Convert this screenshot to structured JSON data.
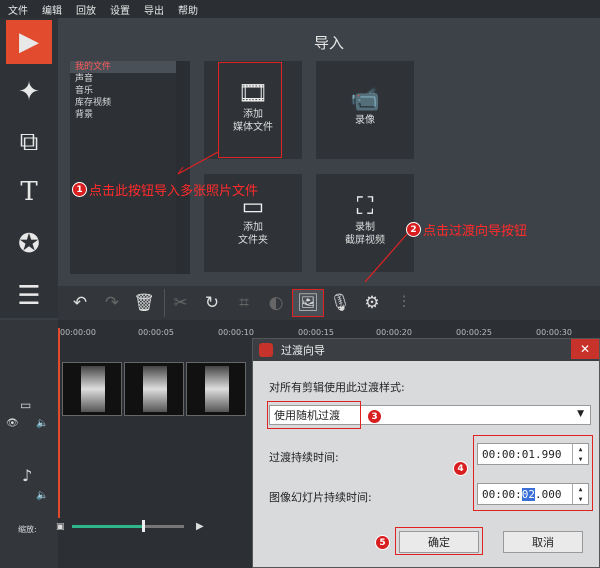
{
  "menu": [
    "文件",
    "编辑",
    "回放",
    "设置",
    "导出",
    "帮助"
  ],
  "panel_title": "导入",
  "file_tree": [
    "我的文件",
    "声音",
    "音乐",
    "库存视频",
    "背景"
  ],
  "tiles": {
    "add_media": "添加\n媒体文件",
    "record": "录像",
    "add_folder": "添加\n文件夹",
    "record_screen": "录制\n截屏视频"
  },
  "annotations": {
    "a1": "点击此按钮导入多张照片文件",
    "a2": "点击过渡向导按钮",
    "n1": "1",
    "n2": "2",
    "n3": "3",
    "n4": "4",
    "n5": "5"
  },
  "ruler": [
    "00:00:00",
    "00:00:05",
    "00:00:10",
    "00:00:15",
    "00:00:20",
    "00:00:25",
    "00:00:30"
  ],
  "zoom_label": "缩放:",
  "dialog": {
    "title": "过渡向导",
    "prompt": "对所有剪辑使用此过渡样式:",
    "style_value": "使用随机过渡",
    "duration_label": "过渡持续时间:",
    "duration_value": "00:00:01.990",
    "slide_label": "图像幻灯片持续时间:",
    "slide_pre": "00:00:",
    "slide_sel": "02",
    "slide_post": ".000",
    "ok": "确定",
    "cancel": "取消"
  },
  "colors": {
    "accent": "#e24b2d",
    "annotation": "#ff2b2b"
  }
}
